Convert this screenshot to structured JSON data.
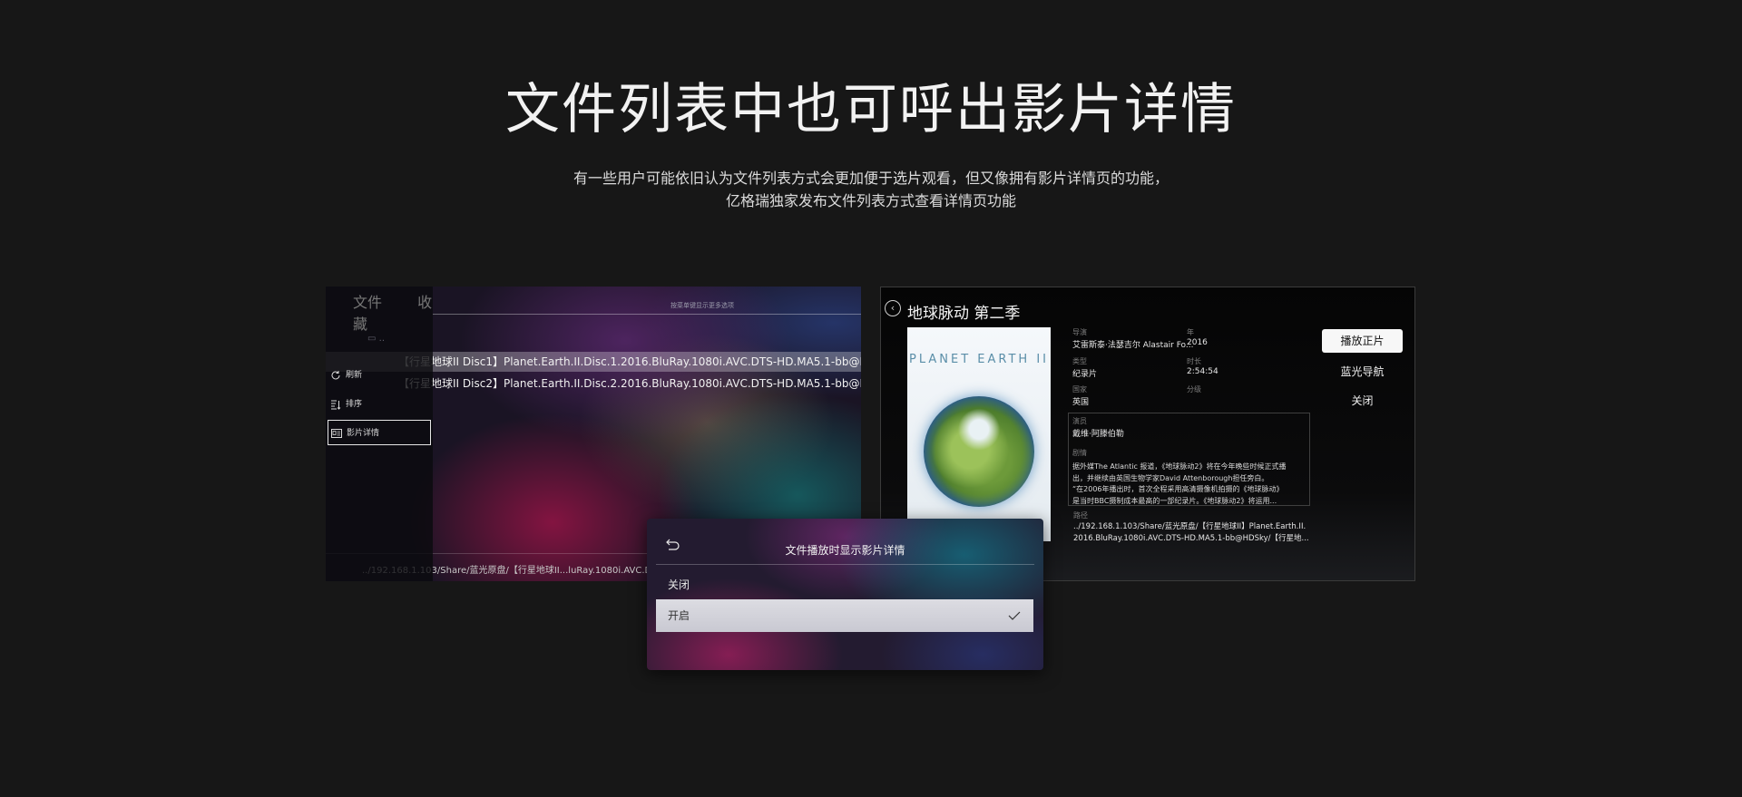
{
  "hero": {
    "title": "文件列表中也可呼出影片详情",
    "subtitle_line1": "有一些用户可能依旧认为文件列表方式会更加便于选片观看，但又像拥有影片详情页的功能，",
    "subtitle_line2": "亿格瑞独家发布文件列表方式查看详情页功能"
  },
  "left_screen": {
    "tabs": [
      "文件",
      "收藏"
    ],
    "header_hint": "按菜单键显示更多选项",
    "folder_up": "..",
    "files": [
      "【行星地球II Disc1】Planet.Earth.II.Disc.1.2016.BluRay.1080i.AVC.DTS-HD.MA5.1-bb@HD. .",
      "【行星地球II Disc2】Planet.Earth.II.Disc.2.2016.BluRay.1080i.AVC.DTS-HD.MA5.1-bb@HD. ."
    ],
    "selected_index": 0,
    "menu": [
      {
        "label": "刷新",
        "icon": "refresh-icon"
      },
      {
        "label": "排序",
        "icon": "sort-icon"
      },
      {
        "label": "影片详情",
        "icon": "details-icon"
      }
    ],
    "active_menu_index": 2,
    "path": "../192.168.1.103/Share/蓝光原盘/【行星地球II...luRay.1080i.AVC.DTS-HD"
  },
  "right_screen": {
    "title": "地球脉动 第二季",
    "poster_text": "PLANET EARTH II",
    "director_label": "导演",
    "director": "艾雷斯泰·法瑟吉尔 Alastair Fo...",
    "year_label": "年",
    "year": "2016",
    "genre_label": "类型",
    "genre": "纪录片",
    "duration_label": "时长",
    "duration": "2:54:54",
    "country_label": "国家",
    "country": "英国",
    "rating_label": "分级",
    "cast_label": "演员",
    "cast": "戴维·阿滕伯勒",
    "plot_label": "剧情",
    "plot_lines": [
      "据外媒The Atlantic 报道，《地球脉动2》将在今年晚些时候正式播",
      "出，并继续由英国生物学家David Attenborough担任旁白。",
      "“在2006年播出时，首次全程采用高清摄像机拍摄的《地球脉动》",
      "是当时BBC摄制成本最高的一部纪录片。《地球脉动2》将运用..."
    ],
    "path_label": "路径",
    "path_lines": [
      "../192.168.1.103/Share/蓝光原盘/【行星地球II】Planet.Earth.II.",
      "2016.BluRay.1080i.AVC.DTS-HD.MA5.1-bb@HDSky/【行星地..."
    ],
    "play_button": "播放正片",
    "nav_button": "蓝光导航",
    "close_button": "关闭"
  },
  "dialog": {
    "title": "文件播放时显示影片详情",
    "option_off": "关闭",
    "option_on": "开启",
    "selected": "开启"
  }
}
